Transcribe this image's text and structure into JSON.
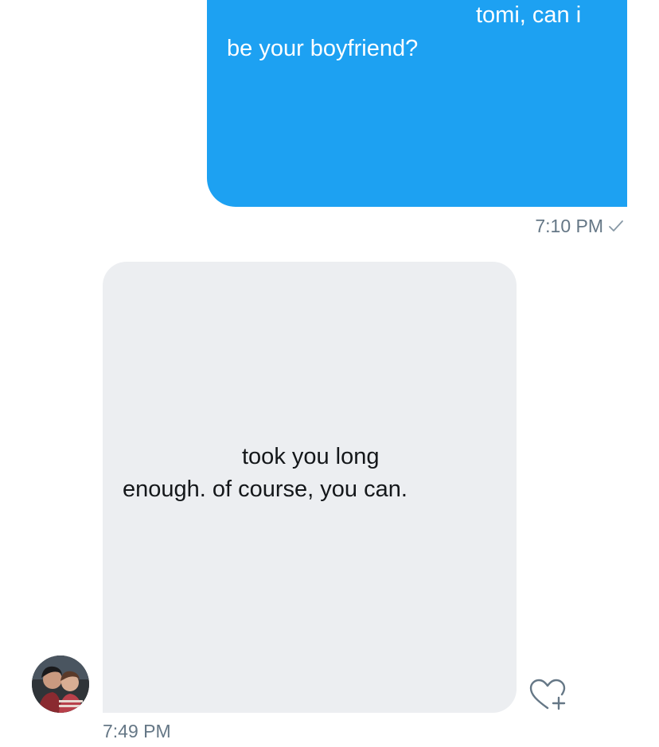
{
  "messages": [
    {
      "direction": "sent",
      "lines": [
        "tomi, can i",
        "be your boyfriend?"
      ],
      "time": "7:10 PM",
      "status_icon": "check-icon"
    },
    {
      "direction": "received",
      "lines": [
        "took you long",
        "enough. of course, you can."
      ],
      "time": "7:49 PM",
      "sender_avatar": "avatar",
      "reaction_icon": "heart-plus-icon"
    }
  ],
  "colors": {
    "sent_bubble": "#1da1f2",
    "received_bubble": "#eceef1",
    "timestamp": "#657786",
    "received_text": "#14171a"
  }
}
